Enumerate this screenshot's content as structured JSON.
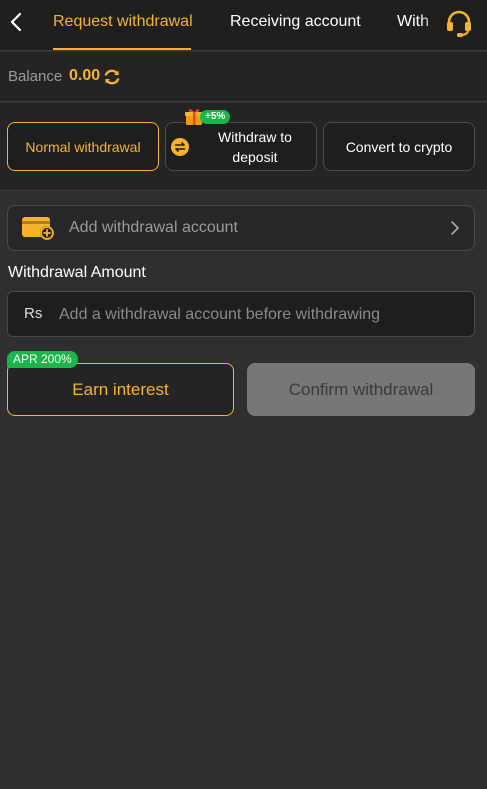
{
  "header": {
    "tabs": [
      {
        "label": "Request withdrawal",
        "active": true
      },
      {
        "label": "Receiving account",
        "active": false
      },
      {
        "label": "With",
        "active": false
      }
    ]
  },
  "balance": {
    "label": "Balance",
    "value": "0.00"
  },
  "methods": {
    "items": [
      {
        "label": "Normal withdrawal",
        "active": true
      },
      {
        "label": "Withdraw to deposit",
        "active": false,
        "badge": "+5%"
      },
      {
        "label": "Convert to crypto",
        "active": false
      }
    ]
  },
  "account": {
    "label": "Add withdrawal account"
  },
  "amount": {
    "label": "Withdrawal Amount",
    "currency": "Rs",
    "placeholder": "Add a withdrawal account before withdrawing"
  },
  "actions": {
    "earn_label": "Earn interest",
    "earn_badge": "APR 200%",
    "confirm_label": "Confirm withdrawal"
  },
  "colors": {
    "accent": "#f7b32b",
    "badge_green": "#19b64a",
    "background": "#2f2f2f"
  },
  "icons": [
    "back-arrow-icon",
    "headset-icon",
    "refresh-icon",
    "gift-icon",
    "swap-icon",
    "wallet-add-icon",
    "chevron-right-icon"
  ]
}
